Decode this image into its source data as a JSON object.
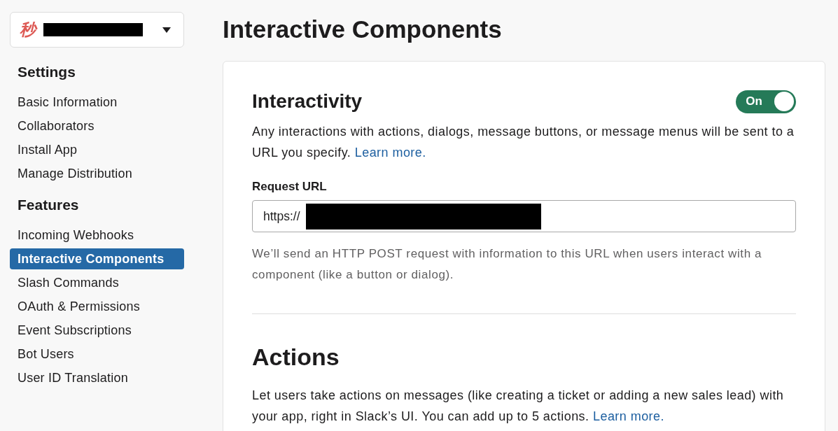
{
  "app_selector": {
    "logo_text": "秒",
    "name_redacted": true
  },
  "sidebar": {
    "sections": [
      {
        "heading": "Settings",
        "items": [
          {
            "label": "Basic Information",
            "selected": false
          },
          {
            "label": "Collaborators",
            "selected": false
          },
          {
            "label": "Install App",
            "selected": false
          },
          {
            "label": "Manage Distribution",
            "selected": false
          }
        ]
      },
      {
        "heading": "Features",
        "items": [
          {
            "label": "Incoming Webhooks",
            "selected": false
          },
          {
            "label": "Interactive Components",
            "selected": true
          },
          {
            "label": "Slash Commands",
            "selected": false
          },
          {
            "label": "OAuth & Permissions",
            "selected": false
          },
          {
            "label": "Event Subscriptions",
            "selected": false
          },
          {
            "label": "Bot Users",
            "selected": false
          },
          {
            "label": "User ID Translation",
            "selected": false
          }
        ]
      }
    ]
  },
  "main": {
    "title": "Interactive Components",
    "interactivity": {
      "heading": "Interactivity",
      "toggle": {
        "label": "On",
        "on": true
      },
      "description": "Any interactions with actions, dialogs, message buttons, or message menus will be sent to a URL you specify.",
      "description_link": "Learn more.",
      "request_url": {
        "label": "Request URL",
        "value": "https://",
        "value_redacted": true
      },
      "help": "We’ll send an HTTP POST request with information to this URL when users interact with a component (like a button or dialog)."
    },
    "actions": {
      "heading": "Actions",
      "description": "Let users take actions on messages (like creating a ticket or adding a new sales lead) with your app, right in Slack’s UI. You can add up to 5 actions.",
      "description_link": "Learn more."
    }
  }
}
